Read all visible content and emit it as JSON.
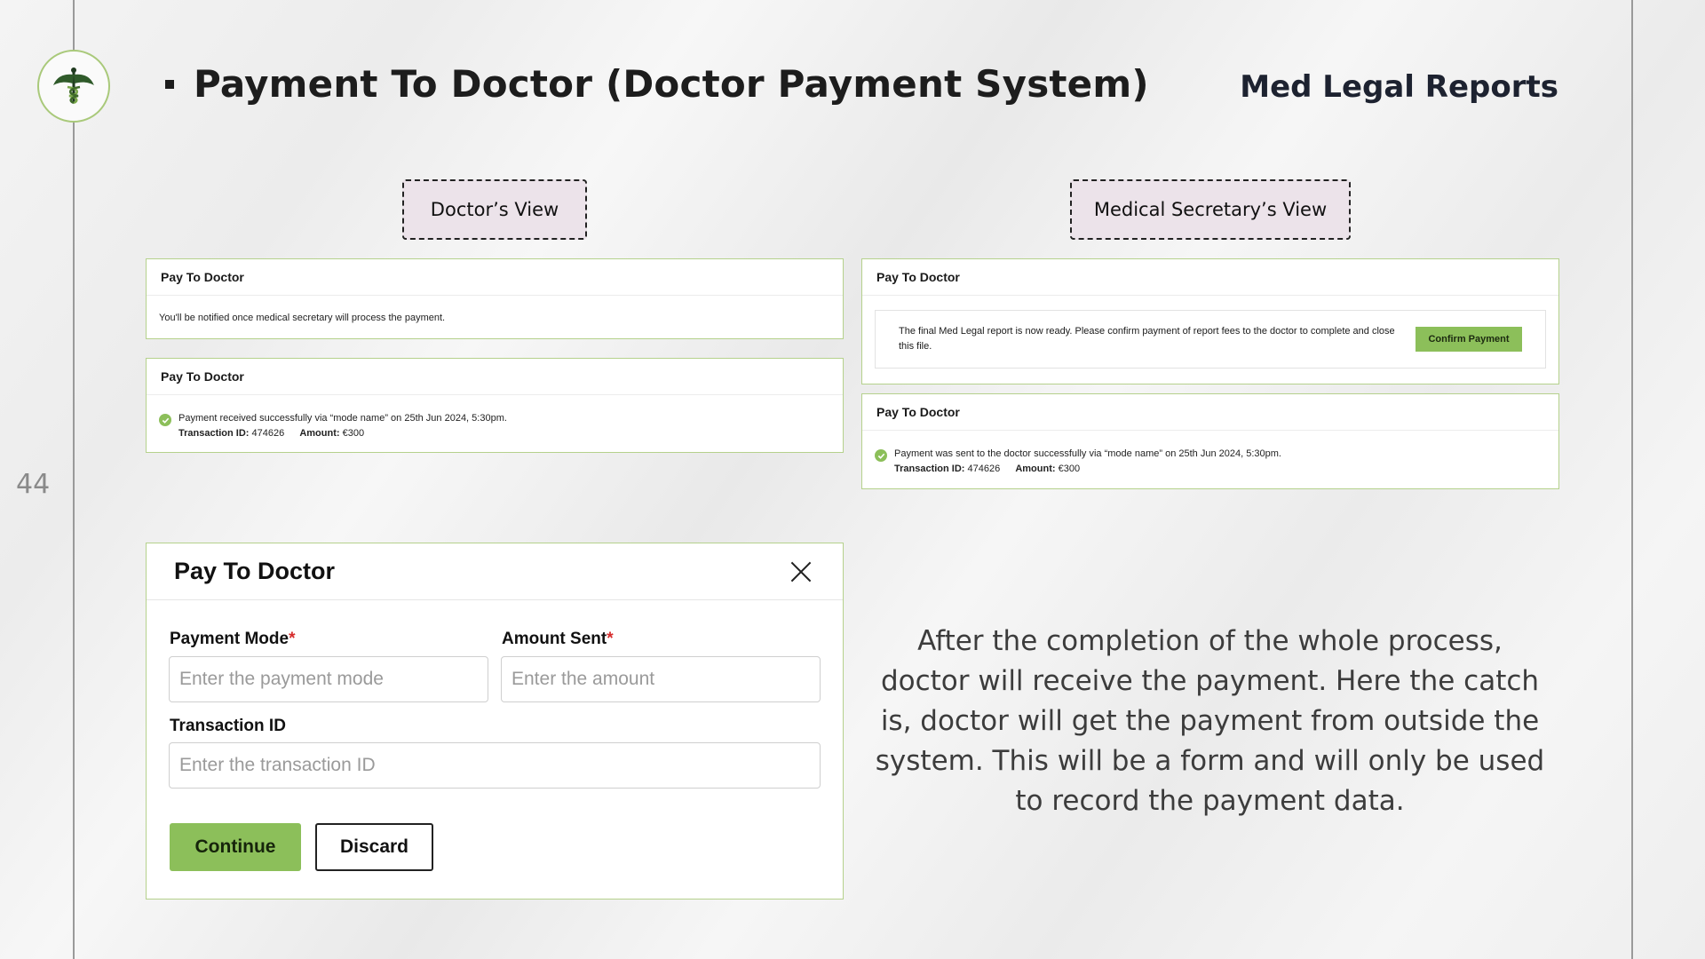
{
  "slide": {
    "page_number": "44",
    "title": "Payment To Doctor (Doctor Payment System)",
    "brand": "Med Legal Reports",
    "description": "After the completion of the whole process, doctor will receive the payment. Here the catch is, doctor will get the payment from outside the system. This will be a form and will only be used to record the payment data.",
    "accent_color": "#8cbf5a"
  },
  "doctor_view": {
    "tag": "Doctor’s View",
    "pending_card": {
      "title": "Pay To Doctor",
      "message": "You'll be notified once medical secretary will process the payment."
    },
    "received_card": {
      "title": "Pay To Doctor",
      "message": "Payment received successfully via “mode name” on 25th Jun 2024, 5:30pm.",
      "transaction_label": "Transaction ID:",
      "transaction_value": "474626",
      "amount_label": "Amount:",
      "amount_value": "€300"
    }
  },
  "secretary_view": {
    "tag": "Medical Secretary’s View",
    "confirm_card": {
      "title": "Pay To Doctor",
      "message": "The final Med Legal report is now ready. Please confirm payment of report fees to the doctor to complete and close this file.",
      "button": "Confirm Payment"
    },
    "sent_card": {
      "title": "Pay To Doctor",
      "message": "Payment was sent to the doctor successfully via “mode name” on 25th Jun 2024, 5:30pm.",
      "transaction_label": "Transaction ID:",
      "transaction_value": "474626",
      "amount_label": "Amount:",
      "amount_value": "€300"
    }
  },
  "form": {
    "title": "Pay To Doctor",
    "payment_mode": {
      "label": "Payment Mode",
      "required_mark": "*",
      "placeholder": "Enter the payment mode"
    },
    "amount_sent": {
      "label": "Amount Sent",
      "required_mark": "*",
      "placeholder": "Enter the amount"
    },
    "transaction_id": {
      "label": "Transaction ID",
      "placeholder": "Enter the transaction ID"
    },
    "continue_button": "Continue",
    "discard_button": "Discard"
  }
}
